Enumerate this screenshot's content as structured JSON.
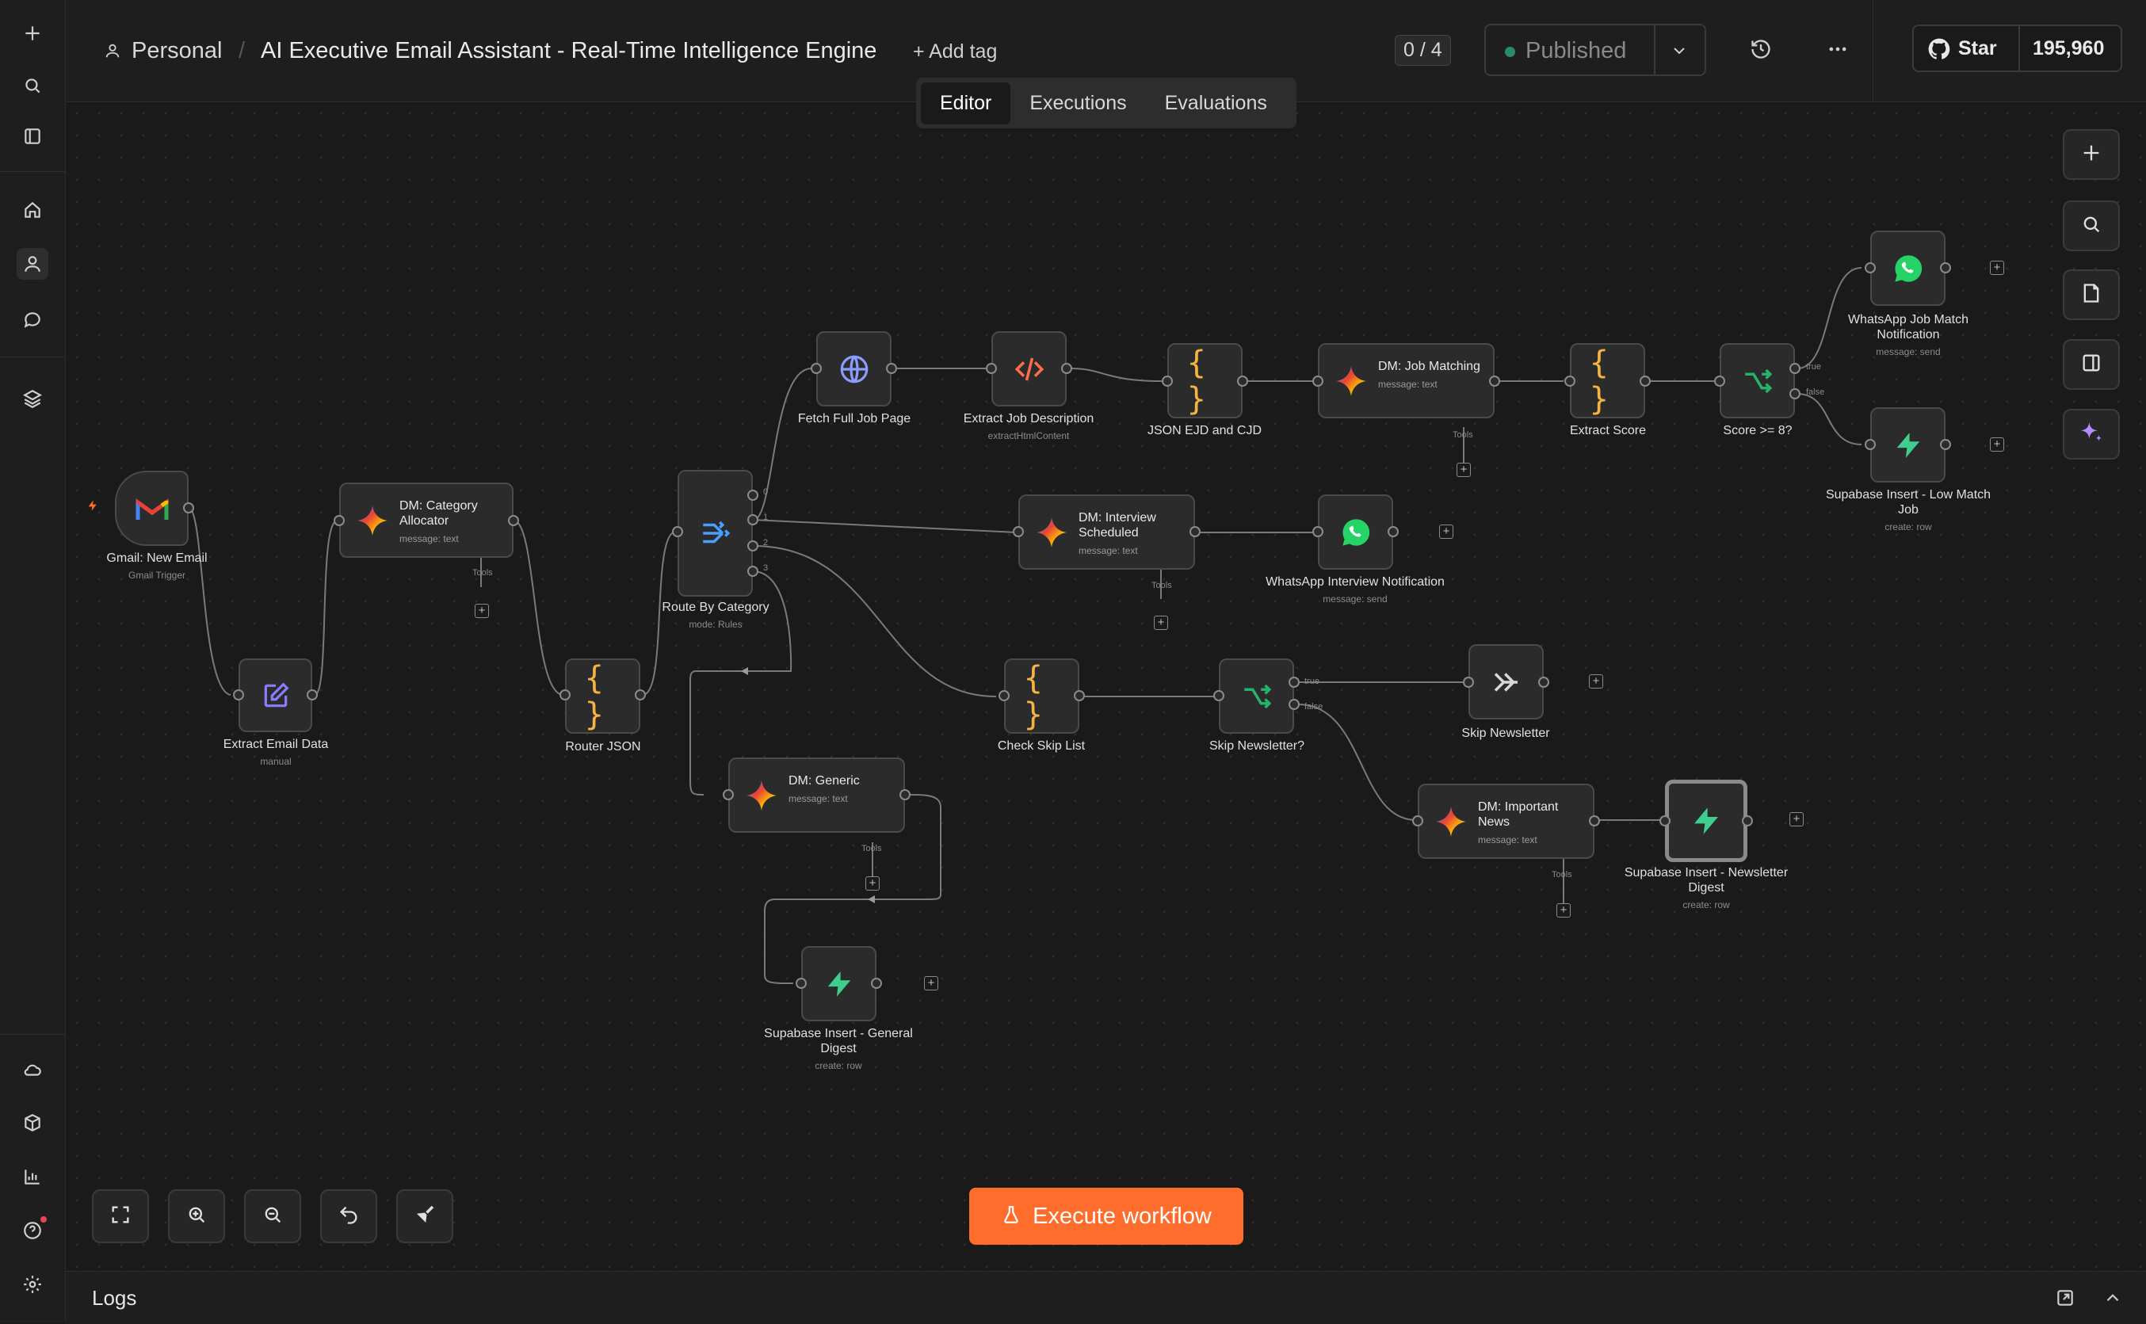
{
  "breadcrumb": {
    "owner": "Personal",
    "title": "AI Executive Email Assistant - Real-Time Intelligence Engine",
    "add_tag": "+ Add tag"
  },
  "header": {
    "counter": "0 / 4",
    "published": "Published",
    "star": "Star",
    "star_count": "195,960"
  },
  "tabs": [
    "Editor",
    "Executions",
    "Evaluations"
  ],
  "execute": "Execute workflow",
  "logs": "Logs",
  "nodes": {
    "gmail": {
      "title": "Gmail: New Email",
      "sub": "Gmail Trigger"
    },
    "extract_email": {
      "title": "Extract Email Data",
      "sub": "manual"
    },
    "category": {
      "title": "DM: Category Allocator",
      "sub": "message: text"
    },
    "router_json": {
      "title": "Router JSON"
    },
    "route": {
      "title": "Route By Category",
      "sub": "mode: Rules"
    },
    "fetch": {
      "title": "Fetch Full Job Page"
    },
    "extract_job": {
      "title": "Extract Job Description",
      "sub": "extractHtmlContent"
    },
    "json_ejd": {
      "title": "JSON EJD and CJD"
    },
    "job_match": {
      "title": "DM: Job Matching",
      "sub": "message: text"
    },
    "extract_score": {
      "title": "Extract Score"
    },
    "score_if": {
      "title": "Score >= 8?"
    },
    "wa_job": {
      "title": "WhatsApp Job Match Notification",
      "sub": "message: send"
    },
    "sb_low": {
      "title": "Supabase Insert - Low Match Job",
      "sub": "create: row"
    },
    "interview": {
      "title": "DM: Interview Scheduled",
      "sub": "message: text"
    },
    "wa_interview": {
      "title": "WhatsApp Interview Notification",
      "sub": "message: send"
    },
    "check_skip": {
      "title": "Check Skip List"
    },
    "skip_if": {
      "title": "Skip Newsletter?"
    },
    "skip_nl": {
      "title": "Skip Newsletter"
    },
    "generic": {
      "title": "DM: Generic",
      "sub": "message: text"
    },
    "important": {
      "title": "DM: Important News",
      "sub": "message: text"
    },
    "sb_news": {
      "title": "Supabase Insert - Newsletter Digest",
      "sub": "create: row"
    },
    "sb_general": {
      "title": "Supabase Insert - General Digest",
      "sub": "create: row"
    }
  },
  "labels": {
    "tools": "Tools",
    "true": "true",
    "false": "false",
    "out0": "0",
    "out1": "1",
    "out2": "2",
    "out3": "3"
  },
  "colors": {
    "accent": "#ff6d2d",
    "published_dot": "#2b8a63",
    "code": "#f5b342",
    "switch": "#25b36b",
    "supabase": "#3ecf8e",
    "whatsapp": "#25d366"
  }
}
